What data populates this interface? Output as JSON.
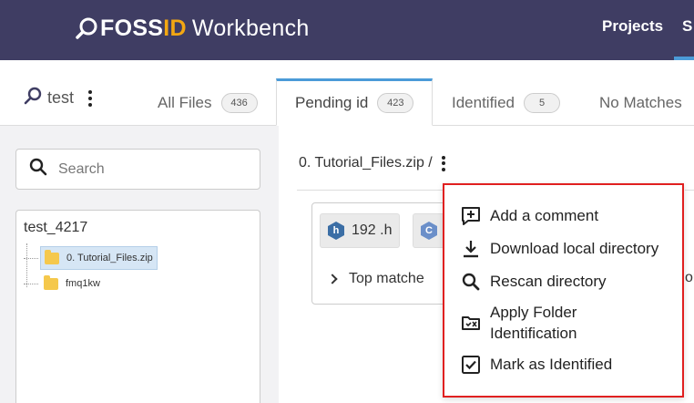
{
  "header": {
    "logo_bold": "FOSS",
    "logo_accent": "ID",
    "logo_rest": "Workbench",
    "nav": [
      {
        "label": "Projects"
      },
      {
        "label": "S"
      }
    ],
    "colors": {
      "bg": "#3f3d63",
      "accent": "#f3a712",
      "active": "#4b9bd8"
    }
  },
  "project": {
    "name": "test",
    "icon": "search-icon"
  },
  "tabs": [
    {
      "label": "All Files",
      "count": "436",
      "active": false
    },
    {
      "label": "Pending id",
      "count": "423",
      "active": true
    },
    {
      "label": "Identified",
      "count": "5",
      "active": false
    },
    {
      "label": "No Matches",
      "count": "",
      "active": false
    }
  ],
  "sidebar": {
    "search_placeholder": "Search",
    "tree": {
      "root": "test_4217",
      "nodes": [
        {
          "label": "0. Tutorial_Files.zip",
          "selected": true
        },
        {
          "label": "fmq1kw",
          "selected": false
        }
      ]
    }
  },
  "main": {
    "breadcrumb": "0. Tutorial_Files.zip /",
    "chips": [
      {
        "icon_letter": "h",
        "label": "192 .h"
      },
      {
        "icon_letter": "C",
        "label": ""
      }
    ],
    "top_matches": "Top matche",
    "right_edge_text": "or"
  },
  "context_menu": {
    "border_color": "#e02020",
    "items": [
      {
        "label": "Add a comment",
        "icon": "add-comment-icon"
      },
      {
        "label": "Download local directory",
        "icon": "download-icon"
      },
      {
        "label": "Rescan directory",
        "icon": "search-icon"
      },
      {
        "label": "Apply Folder Identification",
        "icon": "folder-identify-icon"
      },
      {
        "label": "Mark as Identified",
        "icon": "checkbox-icon"
      }
    ]
  }
}
